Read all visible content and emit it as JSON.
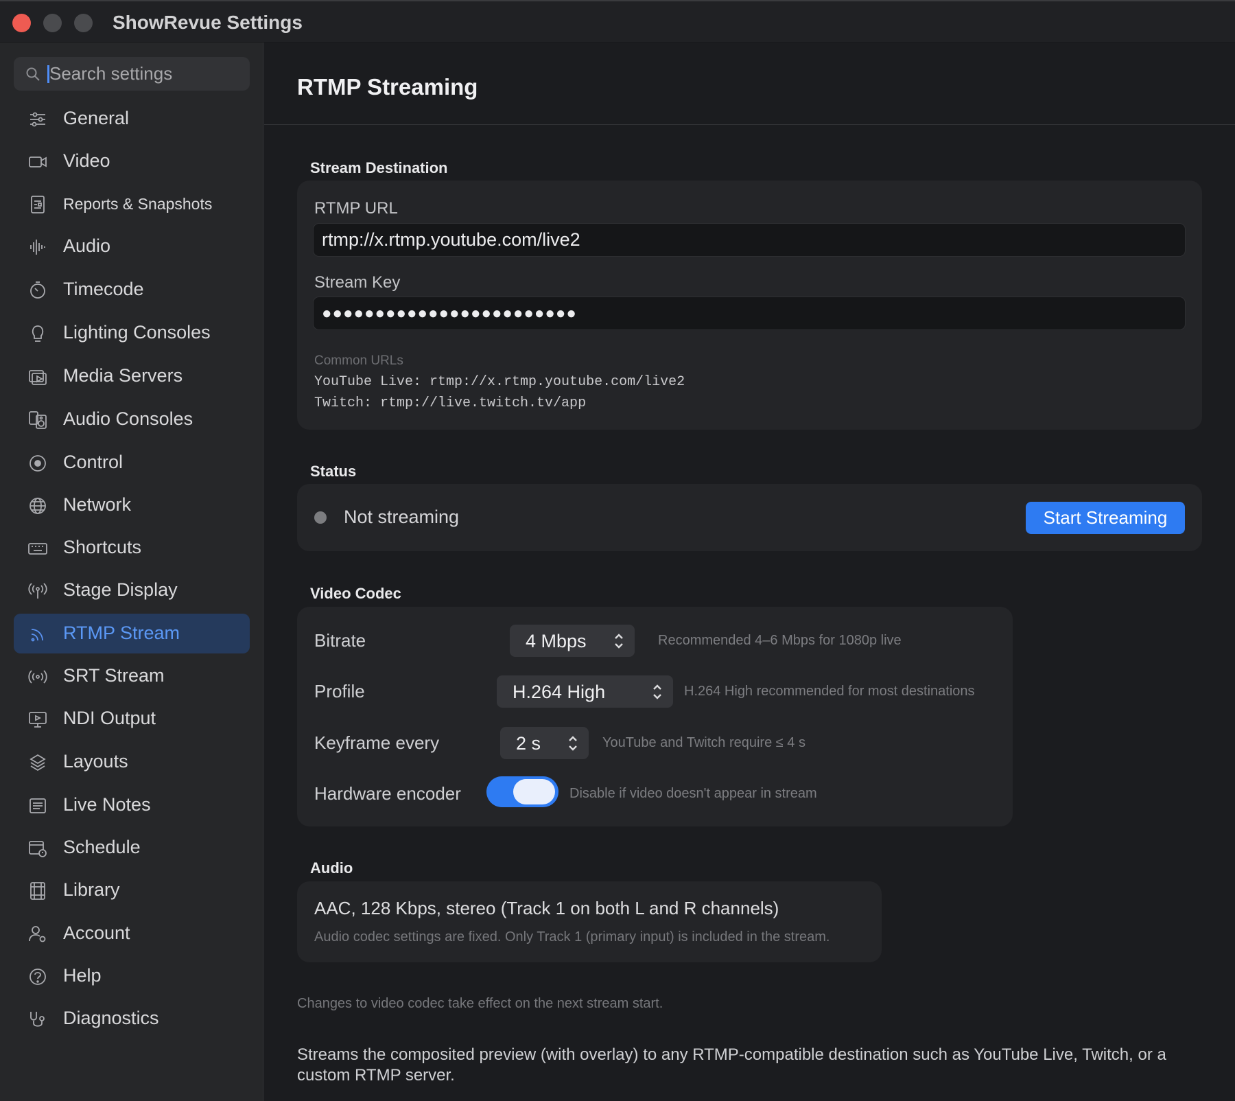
{
  "window": {
    "title": "ShowRevue Settings"
  },
  "search": {
    "placeholder": "Search settings",
    "value": ""
  },
  "sidebar": {
    "items": [
      {
        "label": "General",
        "icon": "sliders-icon",
        "active": false
      },
      {
        "label": "Video",
        "icon": "video-camera-icon",
        "active": false
      },
      {
        "label": "Reports & Snapshots",
        "icon": "report-icon",
        "active": false
      },
      {
        "label": "Audio",
        "icon": "waveform-icon",
        "active": false
      },
      {
        "label": "Timecode",
        "icon": "timer-icon",
        "active": false
      },
      {
        "label": "Lighting Consoles",
        "icon": "lightbulb-icon",
        "active": false
      },
      {
        "label": "Media Servers",
        "icon": "media-play-icon",
        "active": false
      },
      {
        "label": "Audio Consoles",
        "icon": "speaker-icon",
        "active": false
      },
      {
        "label": "Control",
        "icon": "record-circle-icon",
        "active": false
      },
      {
        "label": "Network",
        "icon": "globe-icon",
        "active": false
      },
      {
        "label": "Shortcuts",
        "icon": "keyboard-icon",
        "active": false
      },
      {
        "label": "Stage Display",
        "icon": "broadcast-icon",
        "active": false
      },
      {
        "label": "RTMP Stream",
        "icon": "rss-icon",
        "active": true
      },
      {
        "label": "SRT Stream",
        "icon": "signal-waves-icon",
        "active": false
      },
      {
        "label": "NDI Output",
        "icon": "monitor-icon",
        "active": false
      },
      {
        "label": "Layouts",
        "icon": "layers-icon",
        "active": false
      },
      {
        "label": "Live Notes",
        "icon": "notes-icon",
        "active": false
      },
      {
        "label": "Schedule",
        "icon": "calendar-clock-icon",
        "active": false
      },
      {
        "label": "Library",
        "icon": "film-icon",
        "active": false
      },
      {
        "label": "Account",
        "icon": "user-gear-icon",
        "active": false
      },
      {
        "label": "Help",
        "icon": "help-circle-icon",
        "active": false
      },
      {
        "label": "Diagnostics",
        "icon": "stethoscope-icon",
        "active": false
      }
    ]
  },
  "main": {
    "title": "RTMP Streaming",
    "destination": {
      "section_title": "Stream Destination",
      "url_label": "RTMP URL",
      "url_value": "rtmp://x.rtmp.youtube.com/live2",
      "key_label": "Stream Key",
      "key_value": "●●●●●●●●●●●●●●●●●●●●●●●●",
      "common_title": "Common URLs",
      "common_youtube": "YouTube Live: rtmp://x.rtmp.youtube.com/live2",
      "common_twitch": "Twitch: rtmp://live.twitch.tv/app"
    },
    "status": {
      "section_title": "Status",
      "text": "Not streaming",
      "button_label": "Start Streaming"
    },
    "codec": {
      "section_title": "Video Codec",
      "bitrate_label": "Bitrate",
      "bitrate_value": "4 Mbps",
      "bitrate_hint": "Recommended 4–6 Mbps for 1080p live",
      "profile_label": "Profile",
      "profile_value": "H.264 High",
      "profile_hint": "H.264 High recommended for most destinations",
      "keyframe_label": "Keyframe every",
      "keyframe_value": "2 s",
      "keyframe_hint": "YouTube and Twitch require ≤ 4 s",
      "hw_label": "Hardware encoder",
      "hw_enabled": true,
      "hw_hint": "Disable if video doesn't appear in stream"
    },
    "audio": {
      "section_title": "Audio",
      "summary": "AAC, 128 Kbps, stereo (Track 1 on both L and R channels)",
      "hint": "Audio codec settings are fixed. Only Track 1 (primary input) is included in the stream."
    },
    "footer_note": "Changes to video codec take effect on the next stream start.",
    "footer_description": "Streams the composited preview (with overlay) to any RTMP-compatible destination such as YouTube Live, Twitch, or a custom RTMP server."
  },
  "colors": {
    "accent": "#2e7bf2",
    "active_nav_bg": "#253a5c",
    "close_button": "#ee5b52"
  }
}
